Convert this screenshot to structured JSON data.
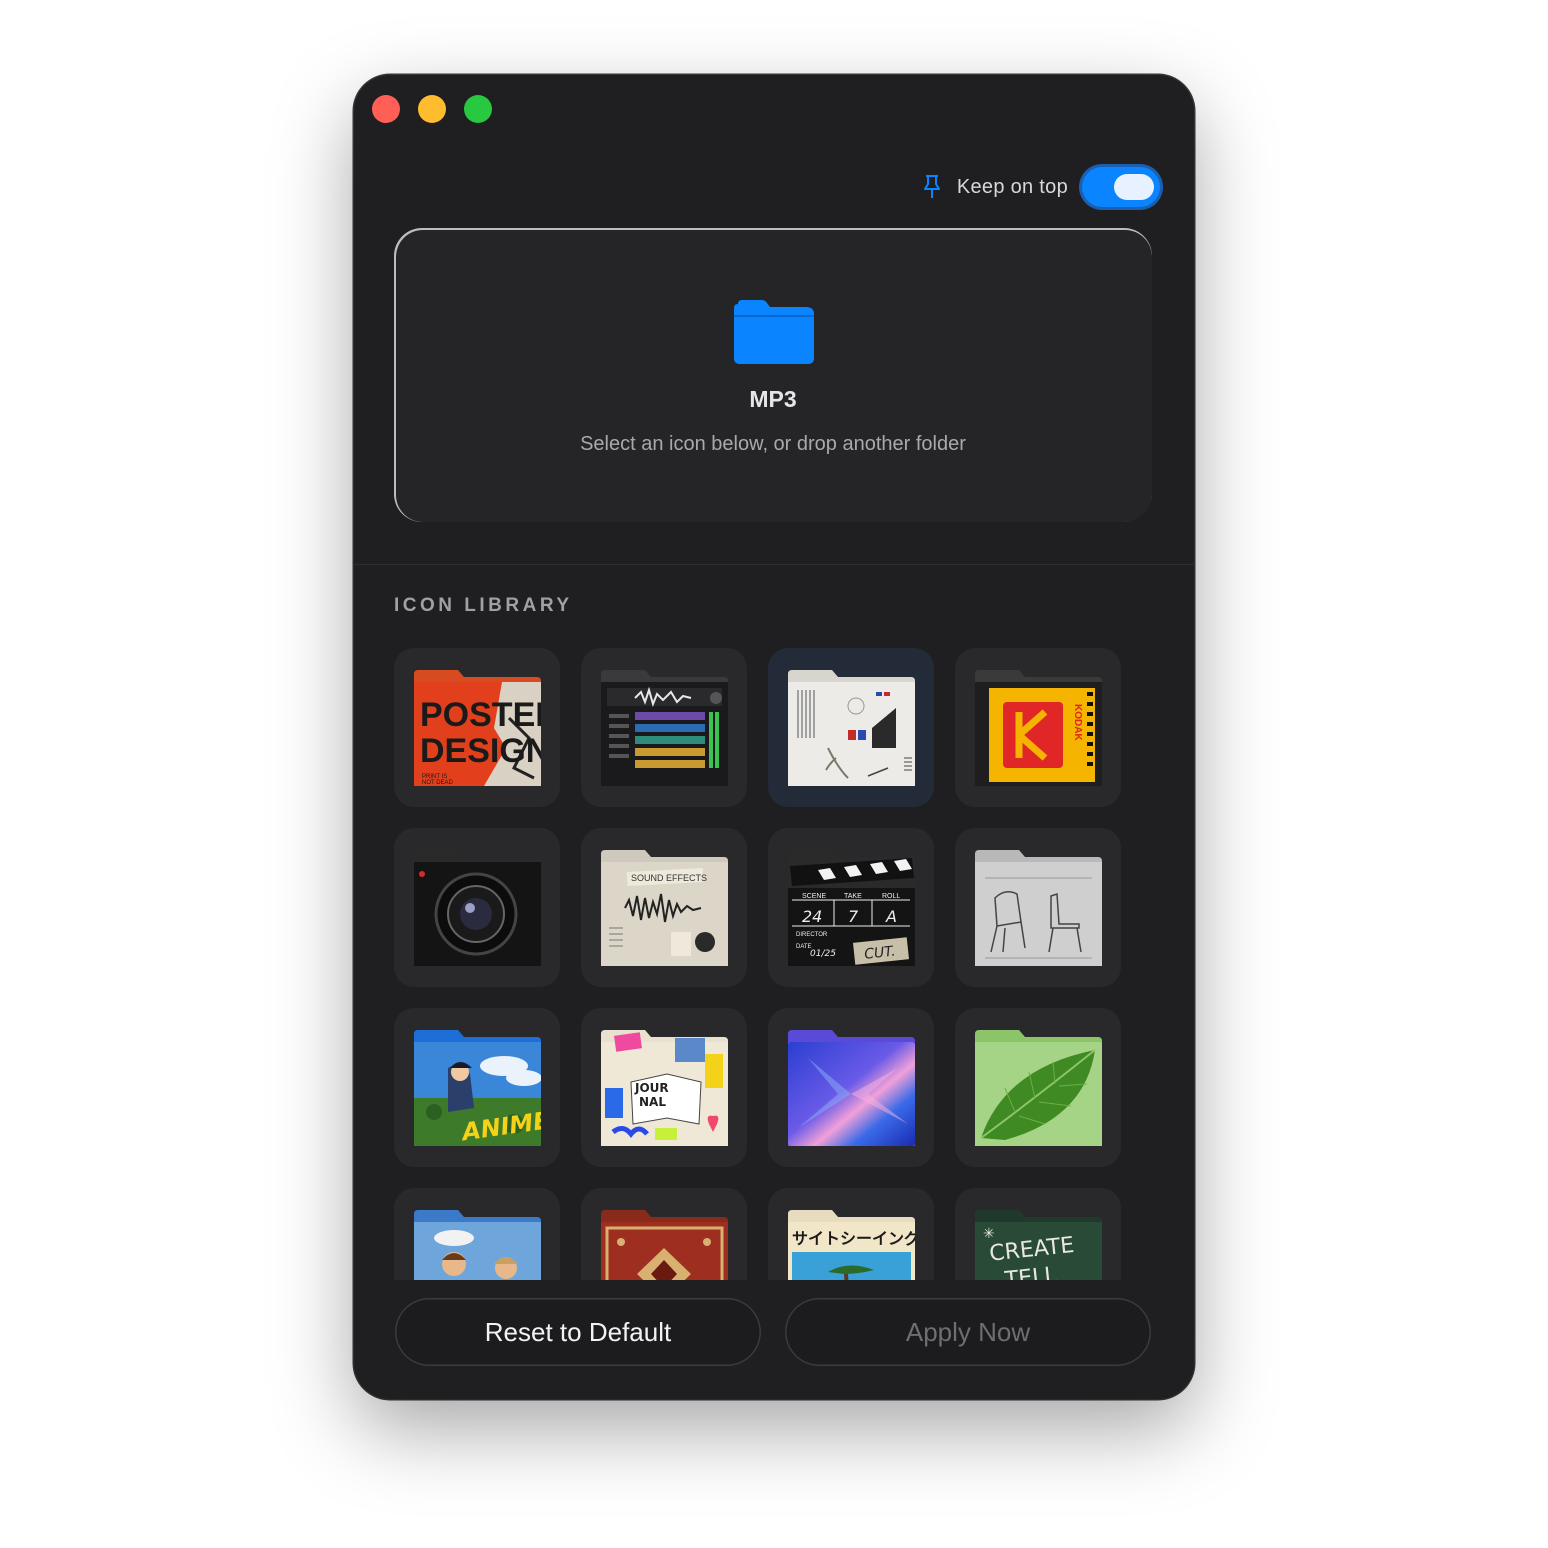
{
  "window": {
    "traffic_lights": [
      "close",
      "minimize",
      "zoom"
    ]
  },
  "header": {
    "keep_on_top_label": "Keep on top",
    "keep_on_top_enabled": true,
    "accent_color": "#0a84ff"
  },
  "drop_zone": {
    "folder_name": "MP3",
    "hint": "Select an icon below, or drop another folder",
    "folder_color": "#0a84ff"
  },
  "library": {
    "title": "ICON LIBRARY",
    "selected_index": 2,
    "icons": [
      {
        "name": "poster-design",
        "text": "POSTER DESIGN",
        "subtext": "PRINT IS NOT DEAD"
      },
      {
        "name": "audio-mixer",
        "text": ""
      },
      {
        "name": "architecture-moodboard",
        "text": ""
      },
      {
        "name": "kodak",
        "text": "KODAK"
      },
      {
        "name": "camera",
        "text": ""
      },
      {
        "name": "sound-effects",
        "text": "SOUND EFFECTS"
      },
      {
        "name": "clapperboard",
        "text": "CUT.",
        "scene": "24",
        "take": "7",
        "roll": "A",
        "date": "01/25"
      },
      {
        "name": "chair-sketch",
        "text": ""
      },
      {
        "name": "anime",
        "text": "ANIME"
      },
      {
        "name": "journal",
        "text": "JOUR NAL"
      },
      {
        "name": "iridescent",
        "text": ""
      },
      {
        "name": "leaf",
        "text": ""
      },
      {
        "name": "renaissance",
        "text": ""
      },
      {
        "name": "persian-rug",
        "text": ""
      },
      {
        "name": "sightseeing",
        "text": "サイトシーイング"
      },
      {
        "name": "create-tell",
        "text": "CREATE TELL"
      }
    ]
  },
  "footer": {
    "reset_label": "Reset to Default",
    "apply_label": "Apply Now"
  }
}
